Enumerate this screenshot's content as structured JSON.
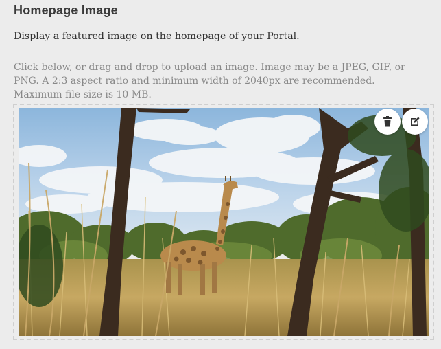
{
  "section": {
    "title": "Homepage Image",
    "description": "Display a featured image on the homepage of your Portal.",
    "help_text": "Click below, or drag and drop to upload an image. Image may be a JPEG, GIF, or PNG. A 2:3 aspect ratio and minimum width of 2040px are recommended. Maximum file size is 10 MB."
  },
  "image": {
    "subject": "giraffe in savanna",
    "alt": ""
  },
  "actions": {
    "delete_icon": "trash-icon",
    "edit_icon": "edit-icon"
  }
}
